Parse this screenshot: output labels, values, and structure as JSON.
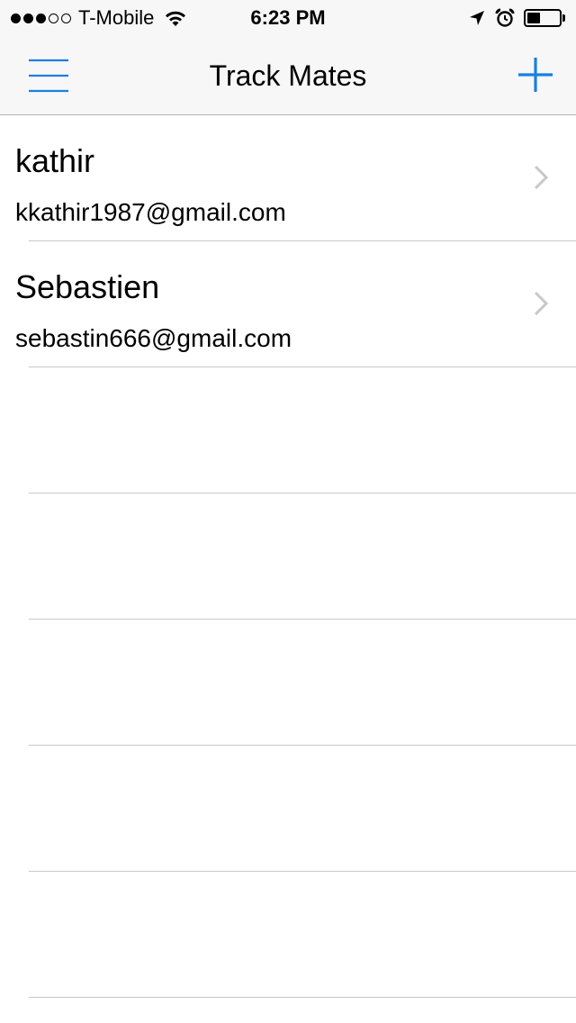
{
  "status_bar": {
    "carrier": "T-Mobile",
    "time": "6:23 PM",
    "signal_strength_bars": 3,
    "signal_total_bars": 5,
    "battery_level": 0.4,
    "icons": [
      "wifi-icon",
      "location-arrow-icon",
      "alarm-icon",
      "battery-icon"
    ]
  },
  "nav": {
    "title": "Track Mates",
    "left_button_icon": "hamburger-menu-icon",
    "right_button_icon": "plus-icon",
    "accent_color": "#1a7fe3"
  },
  "contacts": [
    {
      "name": "kathir",
      "email": "kkathir1987@gmail.com"
    },
    {
      "name": "Sebastien",
      "email": "sebastin666@gmail.com"
    }
  ],
  "colors": {
    "bar_background": "#f7f7f7",
    "separator": "#c8c7cc",
    "chevron": "#c7c7cc"
  }
}
